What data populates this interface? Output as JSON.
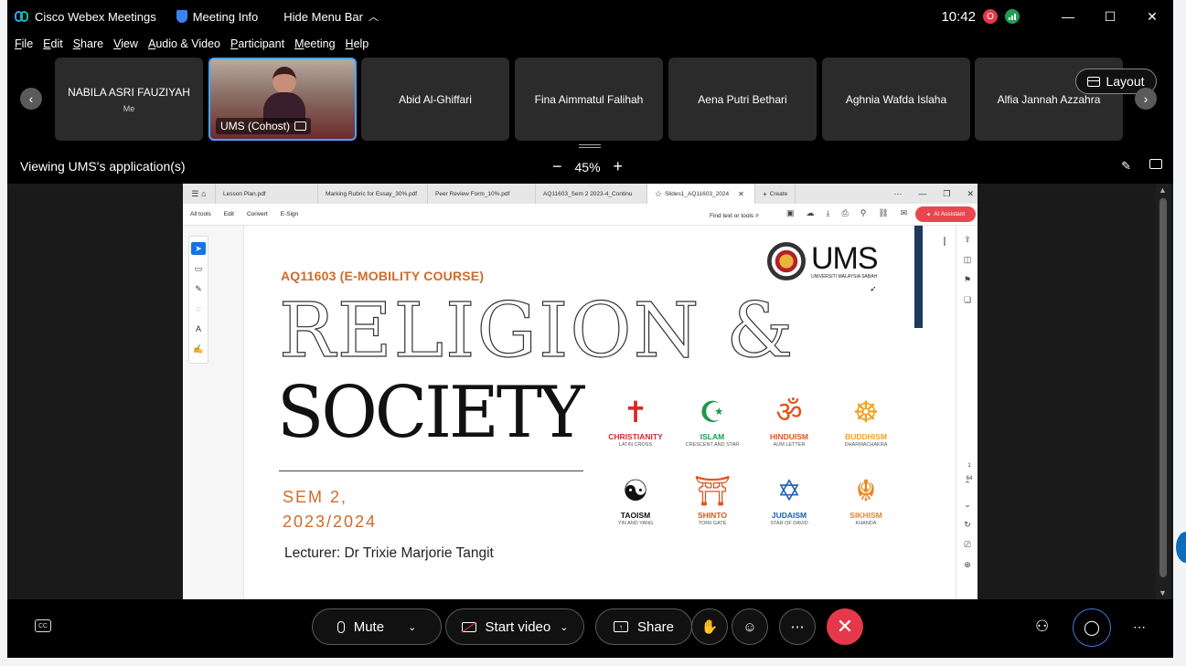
{
  "titlebar": {
    "app_name": "Cisco Webex Meetings",
    "meeting_info": "Meeting Info",
    "hide_menu": "Hide Menu Bar",
    "clock": "10:42",
    "rec_badge": "O"
  },
  "menu": [
    "File",
    "Edit",
    "Share",
    "View",
    "Audio & Video",
    "Participant",
    "Meeting",
    "Help"
  ],
  "participants": [
    {
      "name": "NABILA ASRI FAUZIYAH",
      "sub": "Me"
    },
    {
      "name": "UMS (Cohost)",
      "sub": ""
    },
    {
      "name": "Abid Al-Ghiffari",
      "sub": ""
    },
    {
      "name": "Fina Aimmatul Falihah",
      "sub": ""
    },
    {
      "name": "Aena Putri Bethari",
      "sub": ""
    },
    {
      "name": "Aghnia Wafda Islaha",
      "sub": ""
    },
    {
      "name": "Alfia Jannah Azzahra",
      "sub": ""
    }
  ],
  "layout_label": "Layout",
  "viewing": {
    "label": "Viewing UMS's application(s)",
    "zoom": "45%"
  },
  "acrobat": {
    "tabs": [
      "Lesson Plan.pdf",
      "Marking Rubric for Essay_30%.pdf",
      "Peer Review Form_10%.pdf",
      "AQ11603_Sem 2 2023-4_Continu",
      "Slides1_AQ11603_2024"
    ],
    "create": "Create",
    "tools": [
      "All tools",
      "Edit",
      "Convert",
      "E-Sign"
    ],
    "find": "Find text or tools",
    "ai": "AI Assistant",
    "page_num": "1",
    "page_total": "64"
  },
  "slide": {
    "course": "AQ11603 (E-MOBILITY COURSE)",
    "title1": "RELIGION &",
    "title2": "SOCIETY",
    "sem_line1": "SEM 2,",
    "sem_line2": "2023/2024",
    "lecturer": "Lecturer: Dr Trixie Marjorie Tangit",
    "logo_text": "UMS",
    "logo_sub": "UNIVERSITI MALAYSIA SABAH",
    "religions": [
      {
        "name": "CHRISTIANITY",
        "desc": "LATIN CROSS",
        "symbol": "✝",
        "color": "#d62a2a"
      },
      {
        "name": "ISLAM",
        "desc": "CRESCENT AND STAR",
        "symbol": "☪",
        "color": "#1c9a4c"
      },
      {
        "name": "HINDUISM",
        "desc": "AUM LETTER",
        "symbol": "ॐ",
        "color": "#e0551d"
      },
      {
        "name": "BUDDHISM",
        "desc": "DHARMACHAKRA",
        "symbol": "☸",
        "color": "#f0a31c"
      },
      {
        "name": "TAOISM",
        "desc": "YIN AND YANG",
        "symbol": "☯",
        "color": "#111111"
      },
      {
        "name": "SHINTO",
        "desc": "TORII GATE",
        "symbol": "⛩",
        "color": "#e0551d"
      },
      {
        "name": "JUDAISM",
        "desc": "STAR OF DAVID",
        "symbol": "✡",
        "color": "#1d5fb0"
      },
      {
        "name": "SIKHISM",
        "desc": "KHANDA",
        "symbol": "☬",
        "color": "#e8871e"
      }
    ]
  },
  "controls": {
    "mute": "Mute",
    "start_video": "Start video",
    "share": "Share"
  }
}
